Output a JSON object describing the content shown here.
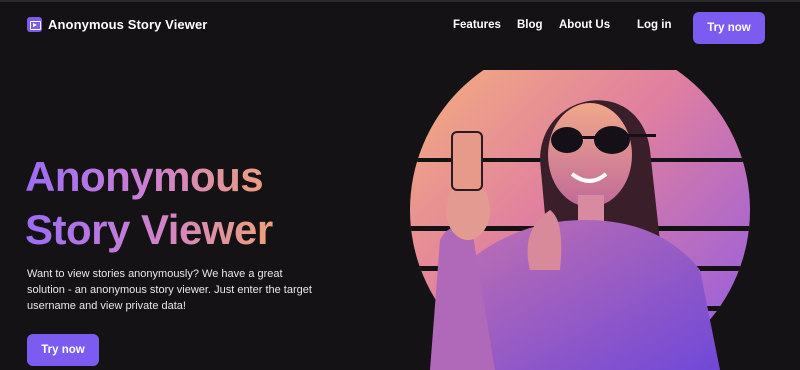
{
  "header": {
    "brand": "Anonymous Story Viewer",
    "logo_icon": "play-screen-icon",
    "nav": [
      "Features",
      "Blog",
      "About Us"
    ],
    "login": "Log in",
    "cta": "Try now"
  },
  "hero": {
    "title_line1": "Anonymous",
    "title_line2": "Story Viewer",
    "description": "Want to view stories anonymously? We have a great solution - an anonymous story viewer. Just enter the target username and view private data!",
    "cta": "Try now",
    "image": "woman-taking-selfie-illustration"
  },
  "colors": {
    "background": "#141214",
    "accent": "#7c5cf0",
    "gradient_start": "#9b6cf4",
    "gradient_end": "#f0a07a"
  }
}
